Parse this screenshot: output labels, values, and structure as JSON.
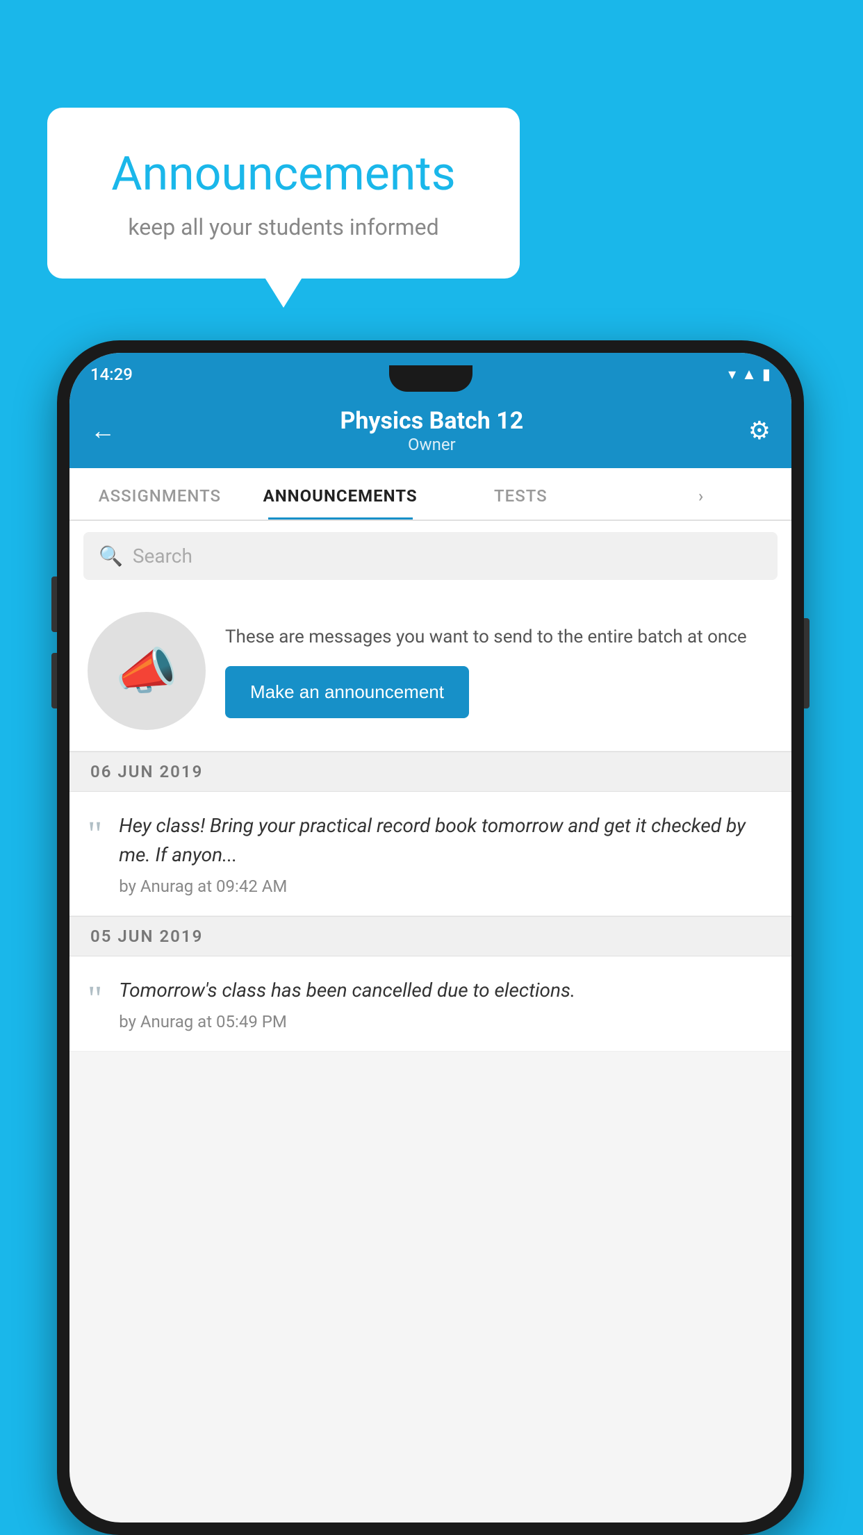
{
  "bubble": {
    "title": "Announcements",
    "subtitle": "keep all your students informed"
  },
  "status_bar": {
    "time": "14:29"
  },
  "header": {
    "title": "Physics Batch 12",
    "subtitle": "Owner"
  },
  "tabs": [
    {
      "label": "ASSIGNMENTS",
      "active": false
    },
    {
      "label": "ANNOUNCEMENTS",
      "active": true
    },
    {
      "label": "TESTS",
      "active": false
    },
    {
      "label": "",
      "active": false
    }
  ],
  "search": {
    "placeholder": "Search"
  },
  "promo": {
    "description": "These are messages you want to send to the entire batch at once",
    "button_label": "Make an announcement"
  },
  "announcements": [
    {
      "date": "06  JUN  2019",
      "text": "Hey class! Bring your practical record book tomorrow and get it checked by me. If anyon...",
      "meta": "by Anurag at 09:42 AM"
    },
    {
      "date": "05  JUN  2019",
      "text": "Tomorrow's class has been cancelled due to elections.",
      "meta": "by Anurag at 05:49 PM"
    }
  ],
  "colors": {
    "primary": "#1790c8",
    "background": "#1ab7ea",
    "white": "#ffffff"
  }
}
